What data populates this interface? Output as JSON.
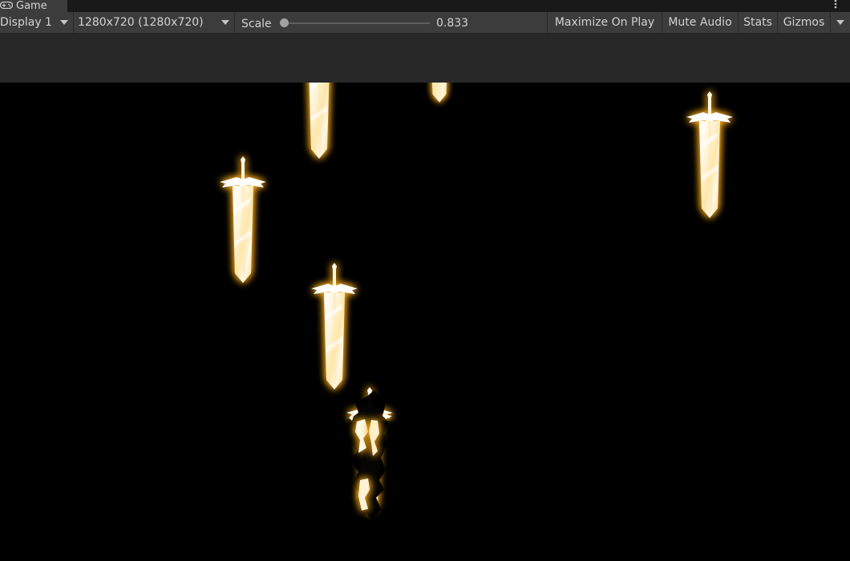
{
  "window": {
    "tab_label": "Game",
    "tab_icon": "gamepad-icon",
    "menu_icon": "kebab-menu-icon"
  },
  "toolbar": {
    "display_label": "Display 1",
    "resolution_label": "1280x720 (1280x720)",
    "scale_label": "Scale",
    "scale_value": "0.833",
    "scale_fraction": 0.0,
    "maximize_label": "Maximize On Play",
    "mute_label": "Mute Audio",
    "stats_label": "Stats",
    "gizmos_label": "Gizmos"
  },
  "colors": {
    "toolbar_bg": "#3c3c3c",
    "strip_bg": "#282828",
    "viewport_bg": "#000000",
    "sword_glow": "#ffb020",
    "text": "#d2d2d2"
  }
}
